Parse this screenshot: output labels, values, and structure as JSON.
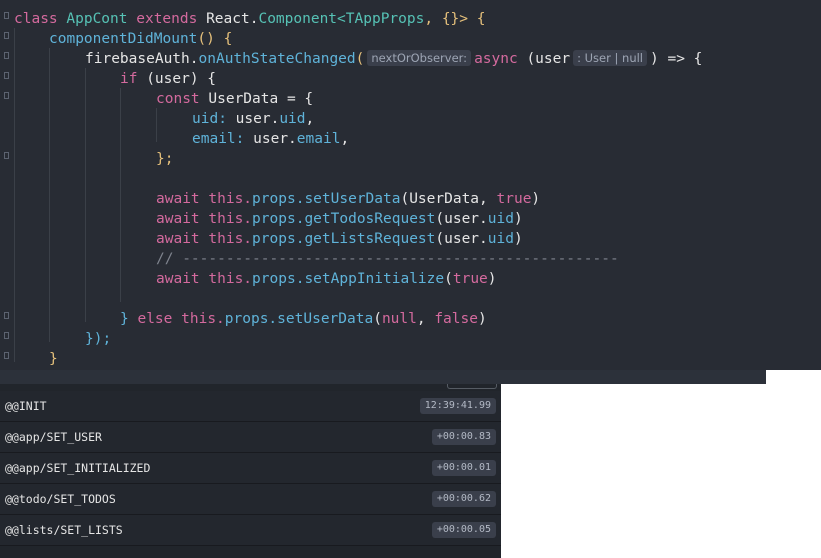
{
  "editor": {
    "line1": {
      "kw_class": "class",
      "class_name": "AppCont",
      "kw_extends": "extends",
      "react": "React.",
      "component": "Component",
      "generic_open": "<",
      "generic_type": "TAppProps",
      "generic_rest": ", {}> {"
    },
    "line2": {
      "method": "componentDidMount",
      "rest": "() {"
    },
    "line3": {
      "object": "firebaseAuth.",
      "method": "onAuthStateChanged",
      "paren": "(",
      "hint_param": "nextOrObserver:",
      "kw_async": "async",
      "arg_open": "(user",
      "hint_type": ": User | null",
      "arrow": ") => {"
    },
    "line4": {
      "kw_if": "if",
      "rest": "(user) {"
    },
    "line5": {
      "kw_const": "const",
      "rest": "UserData = {"
    },
    "line6": {
      "key": "uid:",
      "obj": "user.",
      "prop": "uid",
      "end": ","
    },
    "line7": {
      "key": "email:",
      "obj": "user.",
      "prop": "email",
      "end": ","
    },
    "line8": {
      "text": "};"
    },
    "line9": {
      "kw_await": "await",
      "kw_this": "this.",
      "props": "props.",
      "method": "setUserData",
      "args_pre": "(UserData, ",
      "bool": "true",
      "end": ")"
    },
    "line10": {
      "kw_await": "await",
      "kw_this": "this.",
      "props": "props.",
      "method": "getTodosRequest",
      "args_pre": "(user.",
      "arg_prop": "uid",
      "end": ")"
    },
    "line11": {
      "kw_await": "await",
      "kw_this": "this.",
      "props": "props.",
      "method": "getListsRequest",
      "args_pre": "(user.",
      "arg_prop": "uid",
      "end": ")"
    },
    "line12": {
      "comment": "// --------------------------------------------------"
    },
    "line13": {
      "kw_await": "await",
      "kw_this": "this.",
      "props": "props.",
      "method": "setAppInitialize",
      "args_pre": "(",
      "bool": "true",
      "end": ")"
    },
    "line14": {
      "brace": "}",
      "kw_else": "else",
      "kw_this": "this.",
      "props": "props.",
      "method": "setUserData",
      "args_pre": "(",
      "null": "null",
      "sep": ", ",
      "bool": "false",
      "end": ")"
    },
    "line15": {
      "text": "});"
    },
    "line16": {
      "text": "}"
    }
  },
  "devtools": {
    "actions": [
      {
        "name": "@@INIT",
        "time": "12:39:41.99"
      },
      {
        "name": "@@app/SET_USER",
        "time": "+00:00.83"
      },
      {
        "name": "@@app/SET_INITIALIZED",
        "time": "+00:00.01"
      },
      {
        "name": "@@todo/SET_TODOS",
        "time": "+00:00.62"
      },
      {
        "name": "@@lists/SET_LISTS",
        "time": "+00:00.05"
      }
    ]
  },
  "colors": {
    "editor_bg": "#282c34",
    "keyword": "#d46a9e",
    "function": "#5fb3d9",
    "type": "#56c2b5",
    "bracket": "#e5c07b",
    "devtools_bg": "#21252b"
  }
}
